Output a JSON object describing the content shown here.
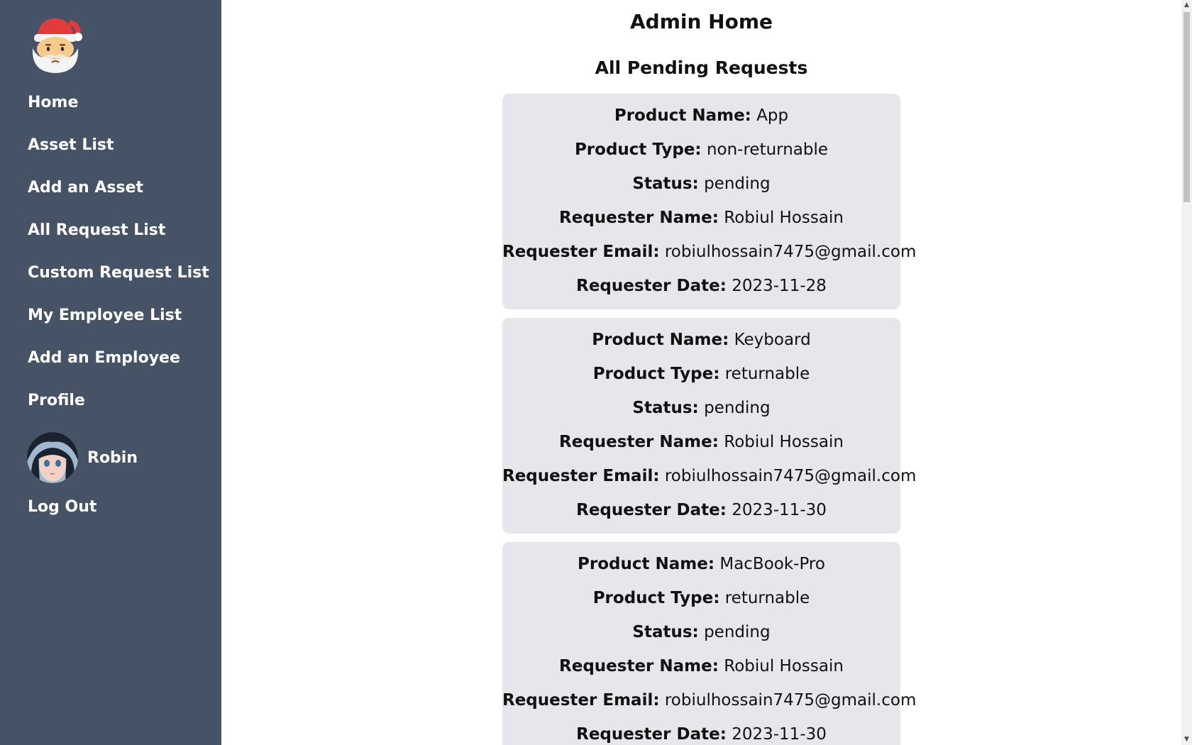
{
  "sidebar": {
    "logo": "santa-claus-icon",
    "items": [
      {
        "label": "Home"
      },
      {
        "label": "Asset List"
      },
      {
        "label": "Add an Asset"
      },
      {
        "label": "All Request List"
      },
      {
        "label": "Custom Request List"
      },
      {
        "label": "My Employee List"
      },
      {
        "label": "Add an Employee"
      },
      {
        "label": "Profile"
      }
    ],
    "user": {
      "name": "Robin",
      "avatar": "user-avatar"
    },
    "logout_label": "Log Out",
    "background_color": "#465366"
  },
  "main": {
    "title": "Admin Home",
    "section_title": "All Pending Requests",
    "field_labels": {
      "product_name": "Product Name:",
      "product_type": "Product Type:",
      "status": "Status:",
      "requester_name": "Requester Name:",
      "requester_email": "Requester Email:",
      "requester_date": "Requester Date:"
    },
    "requests": [
      {
        "product_name": "App",
        "product_type": "non-returnable",
        "status": "pending",
        "requester_name": "Robiul Hossain",
        "requester_email": "robiulhossain7475@gmail.com",
        "requester_date": "2023-11-28"
      },
      {
        "product_name": "Keyboard",
        "product_type": "returnable",
        "status": "pending",
        "requester_name": "Robiul Hossain",
        "requester_email": "robiulhossain7475@gmail.com",
        "requester_date": "2023-11-30"
      },
      {
        "product_name": "MacBook-Pro",
        "product_type": "returnable",
        "status": "pending",
        "requester_name": "Robiul Hossain",
        "requester_email": "robiulhossain7475@gmail.com",
        "requester_date": "2023-11-30"
      }
    ],
    "card_color": "#e6e7eb"
  }
}
